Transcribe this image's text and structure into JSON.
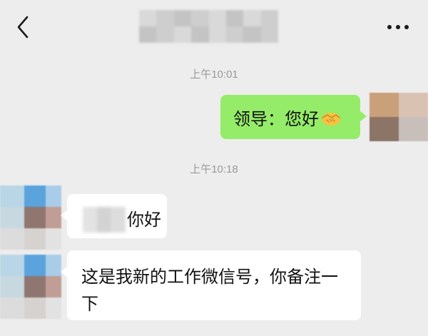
{
  "header": {
    "back_icon": "chevron-left-icon",
    "title": "",
    "more_icon": "more-horizontal-icon"
  },
  "messages": [
    {
      "type": "timestamp",
      "text": "上午10:01"
    },
    {
      "type": "outgoing",
      "text": "领导：您好",
      "emoji": "handshake-icon"
    },
    {
      "type": "timestamp",
      "text": "上午10:18"
    },
    {
      "type": "incoming",
      "text": "你好"
    },
    {
      "type": "incoming",
      "text": "这是我新的工作微信号，你备注一下"
    }
  ],
  "colors": {
    "background": "#ededed",
    "outgoing_bubble": "#95ec69",
    "incoming_bubble": "#ffffff",
    "timestamp_text": "#9a9a9a"
  }
}
